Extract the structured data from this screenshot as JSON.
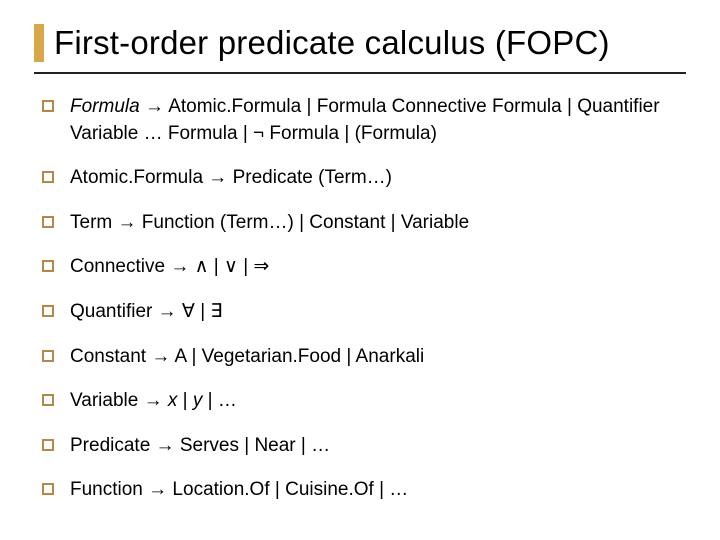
{
  "title": "First-order predicate calculus (FOPC)",
  "bullets": [
    {
      "prefix_italic": "Formula",
      "rest": " → Atomic.Formula | Formula Connective Formula | Quantifier Variable … Formula | ¬ Formula | (Formula)"
    },
    {
      "text": "Atomic.Formula → Predicate (Term…)"
    },
    {
      "text": "Term → Function (Term…) | Constant | Variable"
    },
    {
      "text": "Connective → ∧ | ∨ | ⇒"
    },
    {
      "text": "Quantifier → ∀ | ∃"
    },
    {
      "text": "Constant → A | Vegetarian.Food | Anarkali"
    },
    {
      "prefix": "Variable → ",
      "italic_mid": "x",
      "mid1": " | ",
      "italic_mid2": "y",
      "rest2": " | …"
    },
    {
      "text": "Predicate → Serves | Near | …"
    },
    {
      "text": "Function → Location.Of | Cuisine.Of | …"
    }
  ]
}
